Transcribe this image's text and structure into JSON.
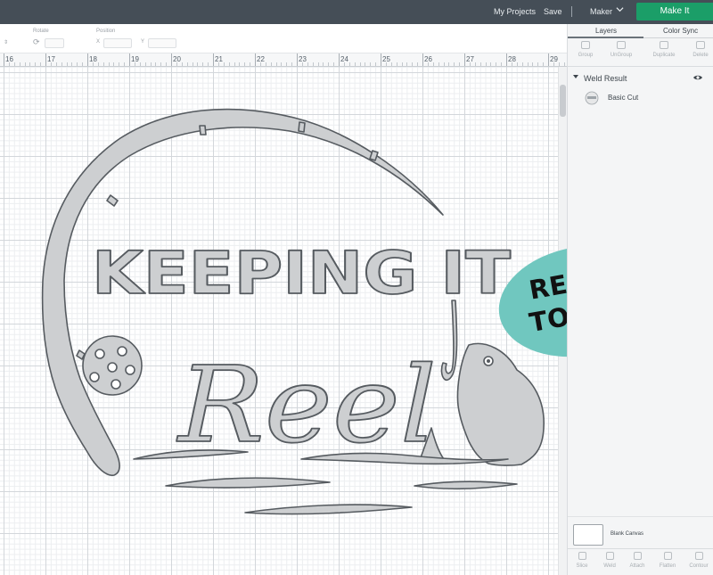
{
  "topbar": {
    "my_projects": "My Projects",
    "save": "Save",
    "divider": "|",
    "maker": "Maker",
    "make_it": "Make It"
  },
  "toolbar": {
    "rotate_label": "Rotate",
    "position_label": "Position",
    "x_label": "X",
    "y_label": "Y"
  },
  "ruler": {
    "numbers": [
      "16",
      "17",
      "18",
      "19",
      "20",
      "21",
      "22",
      "23",
      "24",
      "25",
      "26",
      "27",
      "28",
      "29"
    ]
  },
  "design": {
    "title_text": "KEEPING IT",
    "script_text": "Reel",
    "badge_line1": "READY",
    "badge_line2": "TO CUT",
    "fill_color": "#cdcfd1",
    "stroke_color": "#565b60",
    "badge_color": "#70c7bf"
  },
  "panel": {
    "tab_layers": "Layers",
    "tab_color_sync": "Color Sync",
    "tools": [
      "Group",
      "UnGroup",
      "Duplicate",
      "Delete"
    ],
    "weld_result": "Weld Result",
    "basic_cut": "Basic Cut",
    "blank_canvas": "Blank Canvas",
    "bottom_tools": [
      "Slice",
      "Weld",
      "Attach",
      "Flatten",
      "Contour"
    ]
  }
}
